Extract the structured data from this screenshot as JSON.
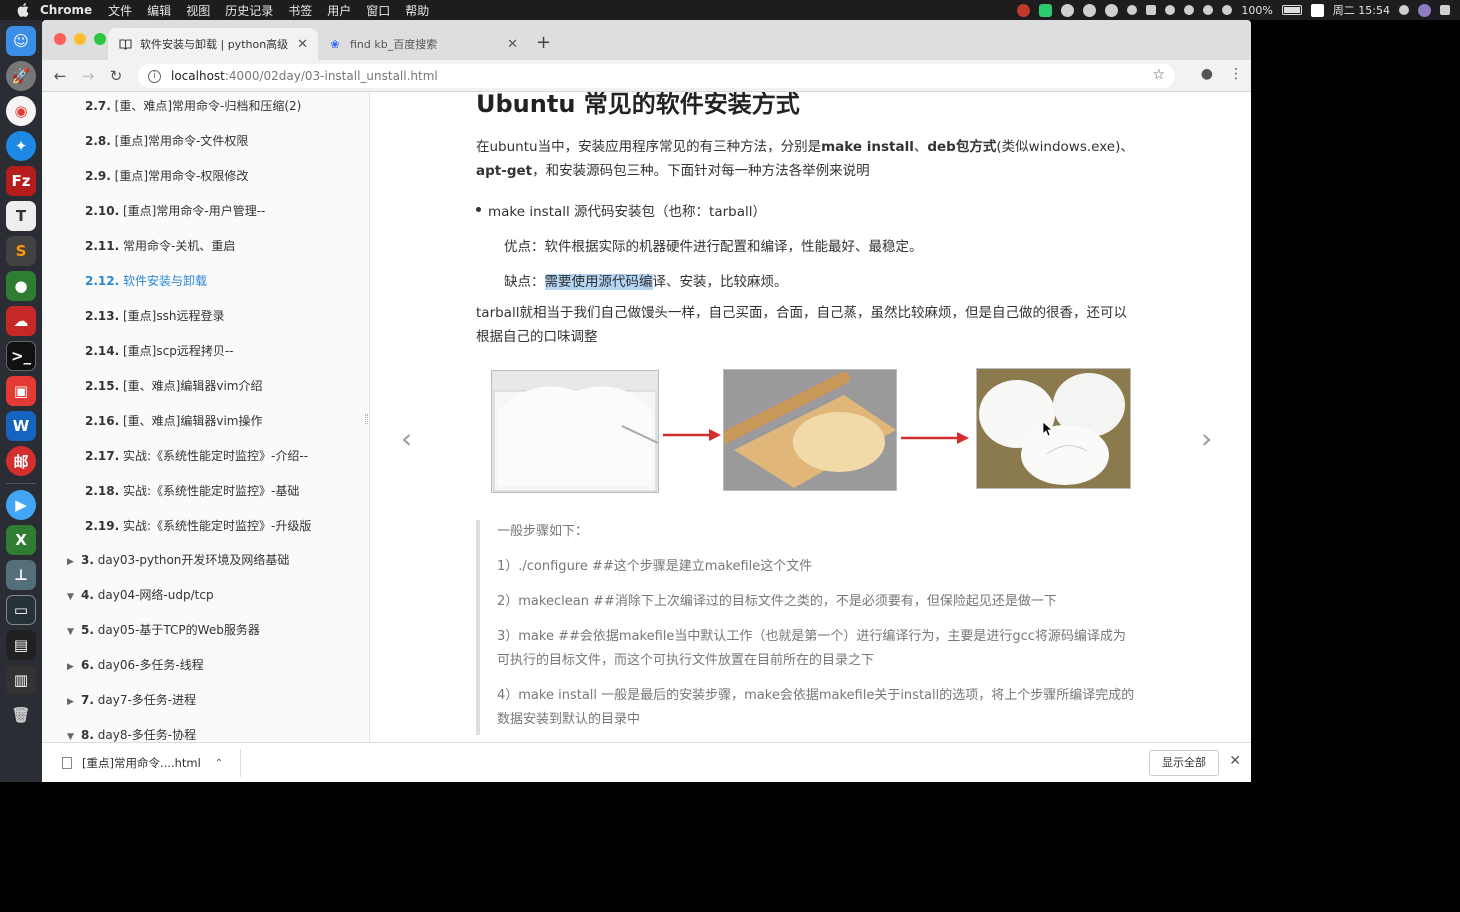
{
  "menubar": {
    "app": "Chrome",
    "items": [
      "文件",
      "编辑",
      "视图",
      "历史记录",
      "书签",
      "用户",
      "窗口",
      "帮助"
    ],
    "battery": "100%",
    "clock": "周二 15:54"
  },
  "browser": {
    "tabs": [
      {
        "title": "软件安装与卸载 | python高级"
      },
      {
        "title": "find kb_百度搜索"
      }
    ],
    "url_host": "localhost",
    "url_path": ":4000/02day/03-install_unstall.html"
  },
  "sidebar": {
    "items": [
      {
        "num": "2.7.",
        "label": "[重、难点]常用命令-归档和压缩(2)"
      },
      {
        "num": "2.8.",
        "label": "[重点]常用命令-文件权限"
      },
      {
        "num": "2.9.",
        "label": "[重点]常用命令-权限修改"
      },
      {
        "num": "2.10.",
        "label": "[重点]常用命令-用户管理--"
      },
      {
        "num": "2.11.",
        "label": "常用命令-关机、重启"
      },
      {
        "num": "2.12.",
        "label": "软件安装与卸载"
      },
      {
        "num": "2.13.",
        "label": "[重点]ssh远程登录"
      },
      {
        "num": "2.14.",
        "label": "[重点]scp远程拷贝--"
      },
      {
        "num": "2.15.",
        "label": "[重、难点]编辑器vim介绍"
      },
      {
        "num": "2.16.",
        "label": "[重、难点]编辑器vim操作"
      },
      {
        "num": "2.17.",
        "label": "实战:《系统性能定时监控》-介绍--"
      },
      {
        "num": "2.18.",
        "label": "实战:《系统性能定时监控》-基础"
      },
      {
        "num": "2.19.",
        "label": "实战:《系统性能定时监控》-升级版"
      }
    ],
    "chapters": [
      {
        "num": "3.",
        "label": "day03-python开发环境及网络基础"
      },
      {
        "num": "4.",
        "label": "day04-网络-udp/tcp"
      },
      {
        "num": "5.",
        "label": "day05-基于TCP的Web服务器"
      },
      {
        "num": "6.",
        "label": "day06-多任务-线程"
      },
      {
        "num": "7.",
        "label": "day7-多任务-进程"
      },
      {
        "num": "8.",
        "label": "day8-多任务-协程"
      }
    ]
  },
  "article": {
    "heading": "Ubuntu 常见的软件安装方式",
    "intro_1": "在ubuntu当中，安装应用程序常见的有三种方法，分别是",
    "intro_b1": "make install",
    "intro_2": "、",
    "intro_b2": "deb包方式",
    "intro_3": "(类似windows.exe)、",
    "intro_b3": "apt-get",
    "intro_4": "，和安装源码包三种。下面针对每一种方法各举例来说明",
    "bullet": "make install 源代码安装包（也称：tarball）",
    "pros": "优点：软件根据实际的机器硬件进行配置和编译，性能最好、最稳定。",
    "cons_prefix": "缺点：",
    "cons_highlight": "需要使用源代码编",
    "cons_suffix": "译、安装，比较麻烦。",
    "tarball_text": "tarball就相当于我们自己做馒头一样，自己买面，合面，自己蒸，虽然比较麻烦，但是自己做的很香，还可以根据自己的口味调整",
    "steps_title": "一般步骤如下：",
    "steps": [
      "1）./configure ##这个步骤是建立makefile这个文件",
      "2）makeclean ##消除下上次编译过的目标文件之类的，不是必须要有，但保险起见还是做一下",
      "3）make ##会依据makefile当中默认工作（也就是第一个）进行编译行为，主要是进行gcc将源码编译成为可执行的目标文件，而这个可执行文件放置在目前所在的目录之下",
      "4）make install 一般是最后的安装步骤，make会依据makefile关于install的选项，将上个步骤所编译完成的数据安装到默认的目录中"
    ]
  },
  "download_bar": {
    "file": "[重点]常用命令....html",
    "show_all": "显示全部"
  }
}
